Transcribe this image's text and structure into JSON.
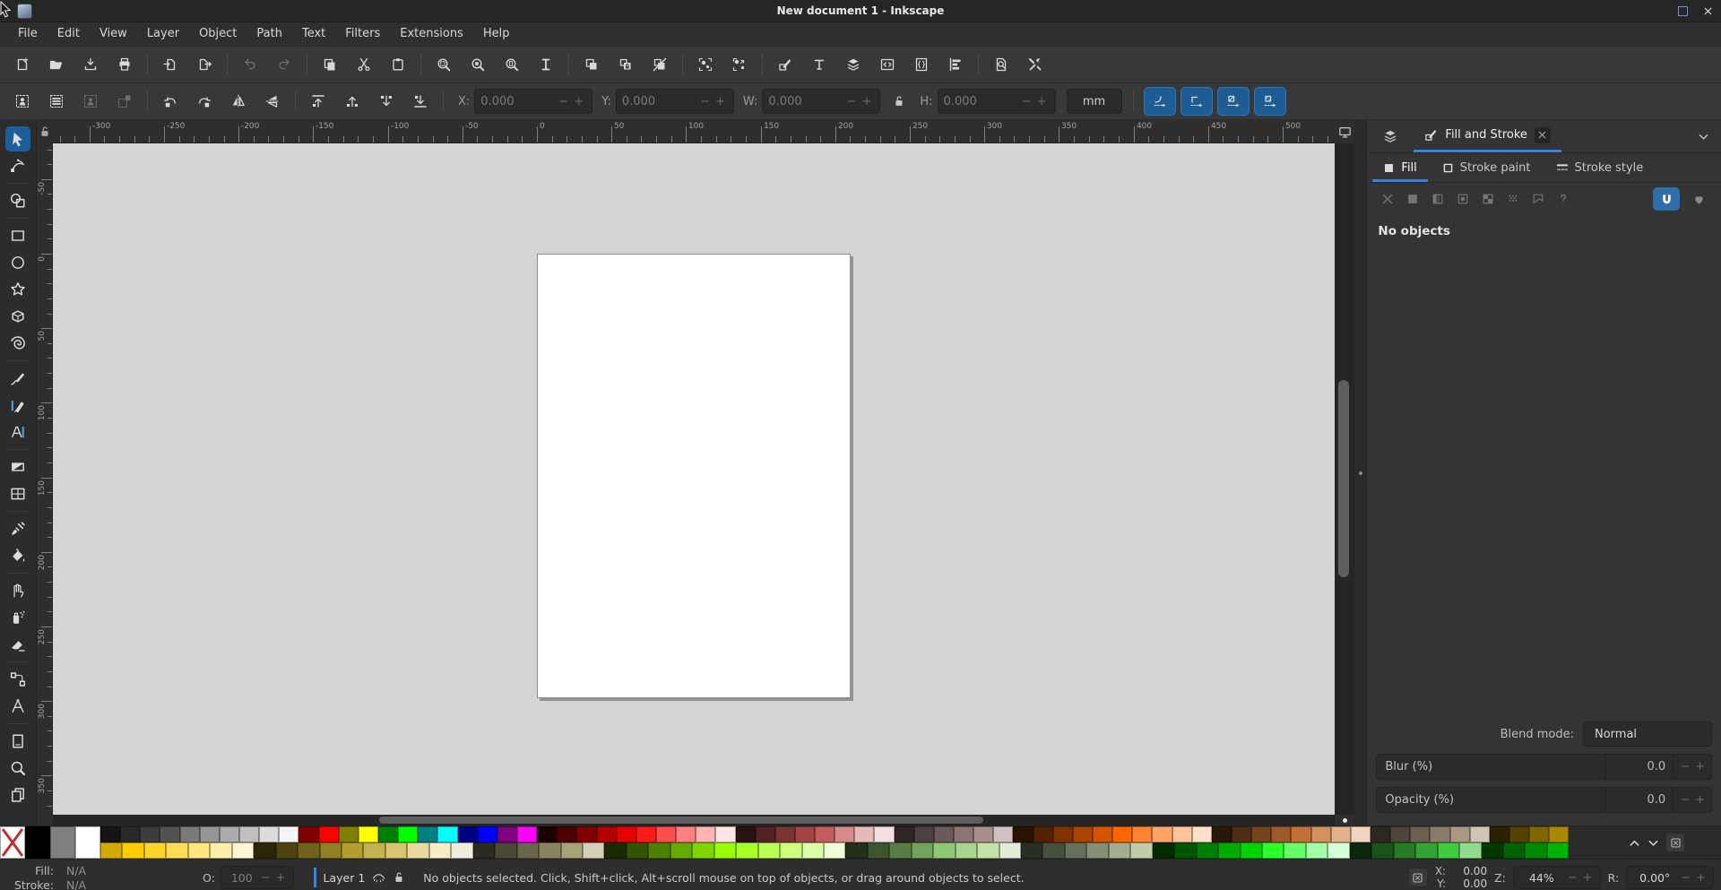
{
  "titlebar": {
    "title": "New document 1 - Inkscape",
    "controls": [
      {
        "icon": "maximize"
      },
      {
        "icon": "close"
      }
    ]
  },
  "menubar": [
    "File",
    "Edit",
    "View",
    "Layer",
    "Object",
    "Path",
    "Text",
    "Filters",
    "Extensions",
    "Help"
  ],
  "commands": [
    [
      {
        "icon": "document-new"
      },
      {
        "icon": "document-open"
      },
      {
        "icon": "document-save"
      },
      {
        "icon": "document-print"
      }
    ],
    [
      {
        "icon": "document-import"
      },
      {
        "icon": "document-export"
      }
    ],
    [
      {
        "icon": "edit-undo",
        "disabled": true
      },
      {
        "icon": "edit-redo",
        "disabled": true
      }
    ],
    [
      {
        "icon": "edit-copy"
      },
      {
        "icon": "edit-cut"
      },
      {
        "icon": "edit-paste"
      }
    ],
    [
      {
        "icon": "zoom-selection"
      },
      {
        "icon": "zoom-drawing"
      },
      {
        "icon": "zoom-page"
      },
      {
        "icon": "zoom-page-width"
      }
    ],
    [
      {
        "icon": "duplicate"
      },
      {
        "icon": "create-clone"
      },
      {
        "icon": "unlink-clone"
      }
    ],
    [
      {
        "icon": "group"
      },
      {
        "icon": "ungroup"
      }
    ],
    [
      {
        "icon": "dialog-fill-stroke"
      },
      {
        "icon": "dialog-text"
      },
      {
        "icon": "dialog-layers"
      },
      {
        "icon": "xml-editor"
      },
      {
        "icon": "dialog-document-properties"
      },
      {
        "icon": "dialog-align"
      }
    ],
    [
      {
        "icon": "dialog-find"
      },
      {
        "icon": "preferences"
      }
    ]
  ],
  "tool_options": {
    "select_buttons": [
      {
        "icon": "select-all"
      },
      {
        "icon": "select-all-layers"
      },
      {
        "icon": "deselect",
        "disabled": true
      },
      {
        "icon": "selection-bbox",
        "disabled": true
      }
    ],
    "transform_buttons": [
      {
        "icon": "rotate-ccw"
      },
      {
        "icon": "rotate-cw"
      },
      {
        "icon": "flip-horizontal"
      },
      {
        "icon": "flip-vertical"
      }
    ],
    "zorder_buttons": [
      {
        "icon": "raise-top"
      },
      {
        "icon": "raise"
      },
      {
        "icon": "lower"
      },
      {
        "icon": "lower-bottom"
      }
    ],
    "fields": [
      {
        "name": "x",
        "label": "X:",
        "value": "0.000"
      },
      {
        "name": "y",
        "label": "Y:",
        "value": "0.000"
      },
      {
        "name": "w",
        "label": "W:",
        "value": "0.000"
      },
      {
        "name": "h",
        "label": "H:",
        "value": "0.000"
      }
    ],
    "unit": "mm",
    "toggle_buttons": [
      {
        "icon": "move-scale-stroke"
      },
      {
        "icon": "move-scale-corners"
      },
      {
        "icon": "move-gradients"
      },
      {
        "icon": "move-patterns"
      }
    ]
  },
  "toolbox": [
    [
      {
        "icon": "selector",
        "active": true
      },
      {
        "icon": "node"
      }
    ],
    [
      {
        "icon": "shape-builder"
      }
    ],
    [
      {
        "icon": "rect"
      },
      {
        "icon": "ellipse"
      },
      {
        "icon": "star"
      },
      {
        "icon": "box3d"
      },
      {
        "icon": "spiral"
      }
    ],
    [
      {
        "icon": "pencil"
      },
      {
        "icon": "calligraphy"
      },
      {
        "icon": "text"
      }
    ],
    [
      {
        "icon": "gradient"
      },
      {
        "icon": "mesh"
      }
    ],
    [
      {
        "icon": "dropper"
      },
      {
        "icon": "bucket"
      }
    ],
    [
      {
        "icon": "tweak"
      },
      {
        "icon": "spray"
      },
      {
        "icon": "eraser"
      }
    ],
    [
      {
        "icon": "connector"
      },
      {
        "icon": "measure"
      }
    ],
    [
      {
        "icon": "page"
      },
      {
        "icon": "zoom"
      },
      {
        "icon": "pages"
      }
    ]
  ],
  "rulers": {
    "h_labels": [
      -300,
      -250,
      -200,
      -150,
      -100,
      -50,
      0,
      50,
      100,
      150,
      200,
      250,
      300,
      350,
      400,
      450,
      500
    ],
    "v_labels": [
      -50,
      0,
      50,
      100,
      150,
      200,
      250,
      300,
      350
    ]
  },
  "dock": {
    "tab_label": "Fill and Stroke",
    "tabs": [
      {
        "label": "Fill",
        "icon": "fill-solid-sq",
        "active": true
      },
      {
        "label": "Stroke paint",
        "icon": "stroke-sq",
        "active": false
      },
      {
        "label": "Stroke style",
        "icon": "stroke-style-ic",
        "active": false
      }
    ],
    "paint_buttons": [
      "no-paint",
      "flat-color",
      "linear-gradient",
      "radial-gradient",
      "pattern-paint",
      "dots-pattern",
      "swatch-paint",
      "unknown-paint"
    ],
    "fill_rule_buttons": [
      {
        "icon": "fill-rule-nz",
        "active": true
      },
      {
        "icon": "fill-rule-eo",
        "active": false
      }
    ],
    "no_objects": "No objects",
    "blend_label": "Blend mode:",
    "blend_value": "Normal",
    "blur_label": "Blur (%)",
    "blur_value": "0.0",
    "opacity_label": "Opacity (%)",
    "opacity_value": "0.0"
  },
  "palette": {
    "tall": [
      "none",
      "#000000",
      "#808080",
      "#ffffff"
    ],
    "top": [
      "#141414",
      "#292929",
      "#3d3d3d",
      "#525252",
      "#7a7a7a",
      "#969696",
      "#ababab",
      "#c0c0c0",
      "#dcdcdc",
      "#f5f5f5",
      "#800000",
      "#ff0000",
      "#808000",
      "#ffff00",
      "#008000",
      "#00ff00",
      "#008080",
      "#00ffff",
      "#000080",
      "#0000ff",
      "#800080",
      "#ff00ff",
      "#1a0000",
      "#4d0000",
      "#800000",
      "#b30000",
      "#e60000",
      "#ff1a1a",
      "#ff4d4d",
      "#ff8080",
      "#ffb3b3",
      "#ffe6e6",
      "#2b1212",
      "#532222",
      "#7b3333",
      "#a34444",
      "#c55c5c",
      "#d68b8b",
      "#e7baba",
      "#f4e0e0",
      "#2e2626",
      "#4d4040",
      "#6c5a5a",
      "#8b7474",
      "#aa8e8e",
      "#d0c2c2",
      "#2b1100",
      "#552200",
      "#803300",
      "#aa4400",
      "#d45500",
      "#ff6600",
      "#ff8533",
      "#ffa366",
      "#ffc299",
      "#ffe0cc",
      "#28170b",
      "#4f2d15",
      "#76431f",
      "#9d5929",
      "#c46f33",
      "#d3915f",
      "#e2b38b",
      "#f1d5c0",
      "#2e2822",
      "#4d443a",
      "#6c6052",
      "#8b7c6a",
      "#aa9882",
      "#d0c4b4",
      "#2b2200",
      "#554400",
      "#806600",
      "#aa8800"
    ],
    "bottom": [
      "#d4aa00",
      "#ffcc00",
      "#ffd42a",
      "#ffdd55",
      "#ffe680",
      "#ffeeaa",
      "#fff6d5",
      "#2b2606",
      "#4d4410",
      "#6f621a",
      "#918024",
      "#b39e2e",
      "#c5b24e",
      "#d7c66f",
      "#e9da9f",
      "#f5ecc8",
      "#f0ecdd",
      "#2b2a20",
      "#4a4836",
      "#69664c",
      "#888462",
      "#a7a278",
      "#d4d0b8",
      "#1a2b00",
      "#335500",
      "#4d8000",
      "#66aa00",
      "#80d400",
      "#99ff00",
      "#aaff2a",
      "#bbff55",
      "#ccff80",
      "#ddffaa",
      "#eeffd5",
      "#22301a",
      "#3d5630",
      "#587c46",
      "#73a25c",
      "#8ec872",
      "#aad48e",
      "#c6e0aa",
      "#e2ecd6",
      "#272e23",
      "#46503e",
      "#656f59",
      "#848e74",
      "#a3ad8f",
      "#c2ccaa",
      "#002b00",
      "#005500",
      "#008000",
      "#00aa00",
      "#00d400",
      "#2aff2a",
      "#66ff66",
      "#a3ffa3",
      "#d5ffd5",
      "#0d290d",
      "#1a521a",
      "#267b26",
      "#33a433",
      "#3fcd3f",
      "#8fdc8f",
      "#003800",
      "#006100",
      "#008a00",
      "#00b300"
    ]
  },
  "statusbar": {
    "fill_label": "Fill:",
    "fill_value": "N/A",
    "stroke_label": "Stroke:",
    "stroke_value": "N/A",
    "opacity_label": "O:",
    "opacity_value": "100",
    "layer_label": "Layer 1",
    "message": "No objects selected. Click, Shift+click, Alt+scroll mouse on top of objects, or drag around objects to select.",
    "x_label": "X:",
    "x_value": "0.00",
    "y_label": "Y:",
    "y_value": "0.00",
    "zoom_label": "Z:",
    "zoom_value": "44%",
    "rotation_label": "R:",
    "rotation_value": "0.00°"
  },
  "accent_colors": {
    "selection_blue": "#3584e4",
    "toggle_blue": "#1e5c94",
    "canvas_gray": "#d4d4d4"
  }
}
